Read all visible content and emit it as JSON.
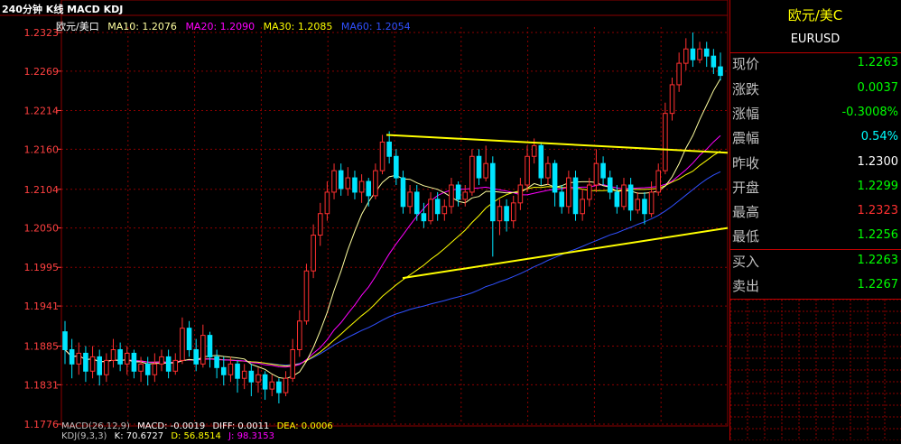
{
  "header": {
    "title": "240分钟 K线 MACD KDJ"
  },
  "ma_legend": {
    "symbol": "欧元/美口",
    "ma10": "MA10: 1.2076",
    "ma20": "MA20: 1.2090",
    "ma30": "MA30: 1.2085",
    "ma60": "MA60: 1.2054"
  },
  "macd_legend": {
    "label": "MACD(26,12,9)",
    "macd": "MACD: -0.0019",
    "diff": "DIFF: 0.0011",
    "dea": "DEA: 0.0006"
  },
  "kdj_legend": {
    "label": "KDJ(9,3,3)",
    "k": "K: 70.6727",
    "d": "D: 56.8514",
    "j": "J: 98.3153"
  },
  "quote_panel": {
    "name": "欧元/美Ⅽ",
    "code": "EURUSD",
    "rows": [
      {
        "label": "现价",
        "value": "1.2263",
        "color": "#00ff00"
      },
      {
        "label": "涨跌",
        "value": "0.0037",
        "color": "#00ff00"
      },
      {
        "label": "涨幅",
        "value": "-0.3008%",
        "color": "#00ff00"
      },
      {
        "label": "震幅",
        "value": "0.54%",
        "color": "#00ffff"
      },
      {
        "label": "昨收",
        "value": "1.2300",
        "color": "#ffffff"
      },
      {
        "label": "开盘",
        "value": "1.2299",
        "color": "#00ff00"
      },
      {
        "label": "最高",
        "value": "1.2323",
        "color": "#ff3030"
      },
      {
        "label": "最低",
        "value": "1.2256",
        "color": "#00ff00"
      },
      {
        "label": "买入",
        "value": "1.2263",
        "color": "#00ff00"
      },
      {
        "label": "卖出",
        "value": "1.2267",
        "color": "#00ff00"
      }
    ]
  },
  "colors": {
    "grid": "#8b0000",
    "axis_text": "#ff4040",
    "up": "#ff3030",
    "down": "#00e5ff",
    "ma10": "#ffffa0",
    "ma20": "#ff00ff",
    "ma30": "#ffff00",
    "ma60": "#3050ff",
    "trendline": "#ffff00"
  },
  "chart_data": {
    "type": "candlestick",
    "y_ticks": [
      "1.2323",
      "1.2269",
      "1.2214",
      "1.2160",
      "1.2104",
      "1.2050",
      "1.1995",
      "1.1941",
      "1.1885",
      "1.1831",
      "1.1776"
    ],
    "ylim": [
      1.1776,
      1.2323
    ],
    "candles": [
      [
        1.1905,
        1.188,
        1.192,
        1.186
      ],
      [
        1.188,
        1.186,
        1.1895,
        1.184
      ],
      [
        1.186,
        1.1875,
        1.189,
        1.1845
      ],
      [
        1.1875,
        1.185,
        1.1885,
        1.1835
      ],
      [
        1.185,
        1.187,
        1.1885,
        1.184
      ],
      [
        1.187,
        1.1845,
        1.188,
        1.183
      ],
      [
        1.1845,
        1.1865,
        1.1875,
        1.1835
      ],
      [
        1.1865,
        1.188,
        1.1895,
        1.1855
      ],
      [
        1.188,
        1.186,
        1.189,
        1.185
      ],
      [
        1.186,
        1.1875,
        1.1885,
        1.1845
      ],
      [
        1.1875,
        1.185,
        1.188,
        1.184
      ],
      [
        1.185,
        1.186,
        1.187,
        1.1835
      ],
      [
        1.186,
        1.1845,
        1.187,
        1.183
      ],
      [
        1.1845,
        1.186,
        1.1875,
        1.1835
      ],
      [
        1.186,
        1.187,
        1.188,
        1.185
      ],
      [
        1.187,
        1.185,
        1.188,
        1.184
      ],
      [
        1.185,
        1.1865,
        1.1875,
        1.1845
      ],
      [
        1.1865,
        1.191,
        1.1925,
        1.186
      ],
      [
        1.191,
        1.188,
        1.192,
        1.187
      ],
      [
        1.188,
        1.186,
        1.1895,
        1.185
      ],
      [
        1.186,
        1.19,
        1.1915,
        1.1855
      ],
      [
        1.19,
        1.187,
        1.1905,
        1.1855
      ],
      [
        1.187,
        1.1855,
        1.188,
        1.184
      ],
      [
        1.1855,
        1.1845,
        1.187,
        1.183
      ],
      [
        1.1845,
        1.186,
        1.187,
        1.1835
      ],
      [
        1.186,
        1.184,
        1.1865,
        1.182
      ],
      [
        1.184,
        1.185,
        1.186,
        1.1825
      ],
      [
        1.185,
        1.1835,
        1.186,
        1.1815
      ],
      [
        1.1835,
        1.1845,
        1.1855,
        1.182
      ],
      [
        1.1845,
        1.1825,
        1.185,
        1.181
      ],
      [
        1.1825,
        1.1835,
        1.1845,
        1.1815
      ],
      [
        1.1835,
        1.182,
        1.184,
        1.1805
      ],
      [
        1.182,
        1.184,
        1.185,
        1.1815
      ],
      [
        1.184,
        1.188,
        1.1895,
        1.1835
      ],
      [
        1.188,
        1.192,
        1.1935,
        1.187
      ],
      [
        1.192,
        1.199,
        1.2,
        1.1915
      ],
      [
        1.199,
        1.204,
        1.2055,
        1.198
      ],
      [
        1.204,
        1.207,
        1.2085,
        1.2025
      ],
      [
        1.207,
        1.21,
        1.2115,
        1.206
      ],
      [
        1.21,
        1.213,
        1.214,
        1.209
      ],
      [
        1.213,
        1.2105,
        1.214,
        1.2095
      ],
      [
        1.2105,
        1.212,
        1.2135,
        1.2095
      ],
      [
        1.212,
        1.21,
        1.213,
        1.209
      ],
      [
        1.21,
        1.2115,
        1.2125,
        1.2085
      ],
      [
        1.2115,
        1.2095,
        1.212,
        1.208
      ],
      [
        1.2095,
        1.213,
        1.214,
        1.209
      ],
      [
        1.213,
        1.217,
        1.218,
        1.2125
      ],
      [
        1.217,
        1.215,
        1.2185,
        1.214
      ],
      [
        1.215,
        1.212,
        1.216,
        1.211
      ],
      [
        1.212,
        1.208,
        1.213,
        1.207
      ],
      [
        1.208,
        1.21,
        1.211,
        1.207
      ],
      [
        1.21,
        1.207,
        1.211,
        1.206
      ],
      [
        1.207,
        1.206,
        1.2085,
        1.205
      ],
      [
        1.206,
        1.209,
        1.21,
        1.2055
      ],
      [
        1.209,
        1.207,
        1.21,
        1.206
      ],
      [
        1.207,
        1.208,
        1.209,
        1.206
      ],
      [
        1.208,
        1.211,
        1.212,
        1.207
      ],
      [
        1.211,
        1.209,
        1.2115,
        1.208
      ],
      [
        1.209,
        1.21,
        1.211,
        1.208
      ],
      [
        1.21,
        1.215,
        1.216,
        1.2095
      ],
      [
        1.215,
        1.212,
        1.216,
        1.211
      ],
      [
        1.212,
        1.214,
        1.2165,
        1.2115
      ],
      [
        1.214,
        1.206,
        1.215,
        1.201
      ],
      [
        1.206,
        1.208,
        1.209,
        1.204
      ],
      [
        1.208,
        1.206,
        1.209,
        1.2045
      ],
      [
        1.206,
        1.2085,
        1.2095,
        1.205
      ],
      [
        1.2085,
        1.211,
        1.212,
        1.2075
      ],
      [
        1.211,
        1.215,
        1.2165,
        1.21
      ],
      [
        1.215,
        1.2165,
        1.2175,
        1.214
      ],
      [
        1.2165,
        1.212,
        1.217,
        1.211
      ],
      [
        1.212,
        1.214,
        1.215,
        1.211
      ],
      [
        1.214,
        1.21,
        1.2145,
        1.208
      ],
      [
        1.21,
        1.208,
        1.211,
        1.207
      ],
      [
        1.208,
        1.212,
        1.213,
        1.207
      ],
      [
        1.212,
        1.207,
        1.213,
        1.206
      ],
      [
        1.207,
        1.209,
        1.2105,
        1.206
      ],
      [
        1.209,
        1.211,
        1.212,
        1.208
      ],
      [
        1.211,
        1.214,
        1.216,
        1.21
      ],
      [
        1.214,
        1.212,
        1.215,
        1.211
      ],
      [
        1.212,
        1.21,
        1.213,
        1.209
      ],
      [
        1.21,
        1.208,
        1.211,
        1.207
      ],
      [
        1.208,
        1.211,
        1.212,
        1.2075
      ],
      [
        1.211,
        1.2075,
        1.212,
        1.206
      ],
      [
        1.2075,
        1.209,
        1.21,
        1.207
      ],
      [
        1.209,
        1.207,
        1.21,
        1.2055
      ],
      [
        1.207,
        1.21,
        1.2115,
        1.2065
      ],
      [
        1.21,
        1.213,
        1.214,
        1.2095
      ],
      [
        1.213,
        1.221,
        1.2225,
        1.2125
      ],
      [
        1.221,
        1.225,
        1.226,
        1.22
      ],
      [
        1.225,
        1.228,
        1.2295,
        1.224
      ],
      [
        1.228,
        1.23,
        1.2315,
        1.227
      ],
      [
        1.23,
        1.2285,
        1.2323,
        1.2275
      ],
      [
        1.2285,
        1.23,
        1.231,
        1.228
      ],
      [
        1.23,
        1.229,
        1.231,
        1.2275
      ],
      [
        1.229,
        1.2275,
        1.23,
        1.2265
      ],
      [
        1.2275,
        1.2263,
        1.2295,
        1.2256
      ]
    ],
    "trendlines": [
      {
        "from": [
          1,
          1.218
        ],
        "to": [
          0,
          1.2155
        ]
      },
      {
        "from": [
          0,
          1.198
        ],
        "to": [
          1,
          1.205
        ]
      }
    ]
  }
}
